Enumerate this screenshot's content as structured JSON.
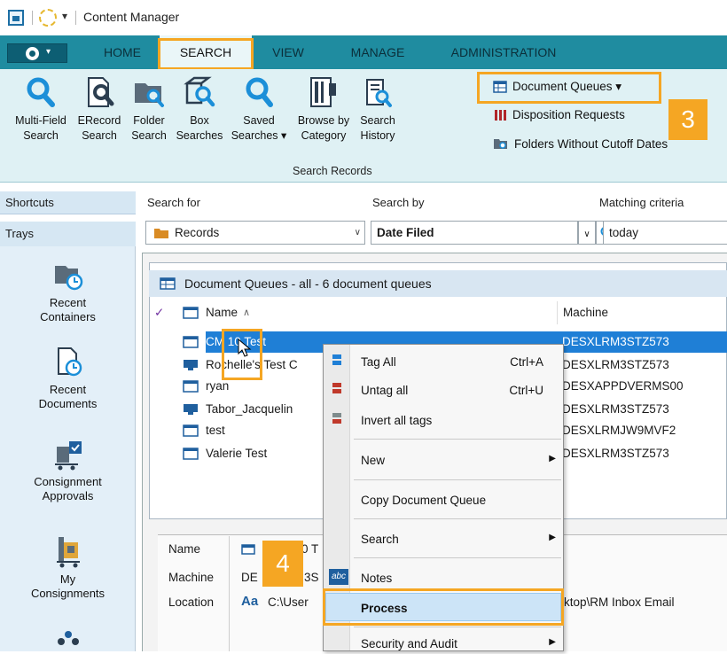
{
  "window": {
    "title": "Content Manager"
  },
  "tabs": [
    "HOME",
    "SEARCH",
    "VIEW",
    "MANAGE",
    "ADMINISTRATION"
  ],
  "ribbon": {
    "buttons": [
      {
        "line1": "Multi-Field",
        "line2": "Search",
        "icon": "magnifier-icon"
      },
      {
        "line1": "ERecord",
        "line2": "Search",
        "icon": "erecord-search-icon"
      },
      {
        "line1": "Folder",
        "line2": "Search",
        "icon": "folder-search-icon"
      },
      {
        "line1": "Box",
        "line2": "Searches",
        "icon": "box-search-icon"
      },
      {
        "line1": "Saved",
        "line2": "Searches ▾",
        "icon": "magnifier-icon"
      },
      {
        "line1": "Browse by",
        "line2": "Category",
        "icon": "category-icon"
      },
      {
        "line1": "Search",
        "line2": "History",
        "icon": "history-icon"
      }
    ],
    "small": {
      "document_queues": "Document Queues ▾",
      "disposition_requests": "Disposition Requests",
      "folders_without_cutoff": "Folders Without Cutoff Dates"
    },
    "group_label": "Search Records"
  },
  "search_bar": {
    "search_for_label": "Search for",
    "search_by_label": "Search by",
    "matching_label": "Matching criteria",
    "search_for_value": "Records",
    "search_by_value": "Date Filed",
    "matching_value": "today"
  },
  "left_panel": {
    "shortcuts": "Shortcuts",
    "trays": "Trays",
    "items": [
      {
        "line1": "Recent",
        "line2": "Containers"
      },
      {
        "line1": "Recent",
        "line2": "Documents"
      },
      {
        "line1": "Consignment",
        "line2": "Approvals"
      },
      {
        "line1": "My",
        "line2": "Consignments"
      }
    ]
  },
  "list": {
    "title": "Document Queues - all - 6 document queues",
    "col_name": "Name",
    "col_machine": "Machine",
    "rows": [
      {
        "name": "CM 10 Test",
        "machine": "DESXLRM3STZ573"
      },
      {
        "name": "Rochelle's Test C",
        "machine": "DESXLRM3STZ573"
      },
      {
        "name": "ryan",
        "machine": "DESXAPPDVERMS00"
      },
      {
        "name": "Tabor_Jacquelin",
        "machine": "DESXLRM3STZ573"
      },
      {
        "name": "test",
        "machine": "DESXLRMJW9MVF2"
      },
      {
        "name": "Valerie Test",
        "machine": "DESXLRM3STZ573"
      }
    ]
  },
  "details": {
    "name_label": "Name",
    "machine_label": "Machine",
    "location_label": "Location",
    "name_value": "0 T",
    "machine_value_a": "DE",
    "machine_value_b": "3S",
    "location_value": "C:\\User",
    "location_tail": "ktop\\RM Inbox Email"
  },
  "context_menu": {
    "tag_all": "Tag All",
    "tag_all_sc": "Ctrl+A",
    "untag_all": "Untag all",
    "untag_all_sc": "Ctrl+U",
    "invert_tags": "Invert all tags",
    "new": "New",
    "copy": "Copy Document Queue",
    "search": "Search",
    "notes": "Notes",
    "process": "Process",
    "security": "Security and Audit"
  },
  "callouts": {
    "step3": "3",
    "step4": "4"
  },
  "colors": {
    "ribbon_tabs": "#1f8ca0",
    "ribbon_body": "#dff1f4",
    "highlight": "#f5a623",
    "selection": "#1f7fd6"
  }
}
